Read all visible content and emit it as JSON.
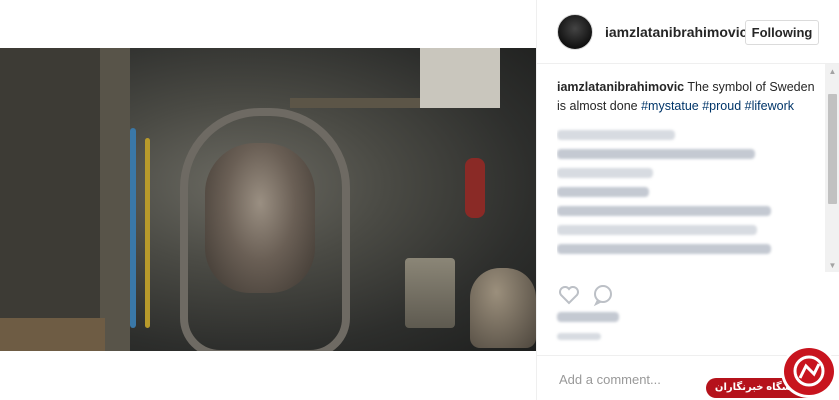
{
  "post": {
    "username": "iamzlatanibrahimovic",
    "follow_label": "Following",
    "caption_user": "iamzlatanibrahimovic",
    "caption_text": " The symbol of Sweden is almost done ",
    "hashtags": [
      "#mystatue",
      "#proud",
      "#lifework"
    ]
  },
  "comment_box": {
    "placeholder": "Add a comment..."
  },
  "icons": {
    "like": "heart-icon",
    "comment": "comment-icon",
    "more": "more-options-icon"
  },
  "watermark": {
    "text": "باشگاه خبرنگاران"
  },
  "colors": {
    "hashtag": "#003569",
    "watermark": "#c8141e",
    "border": "#efefef"
  }
}
